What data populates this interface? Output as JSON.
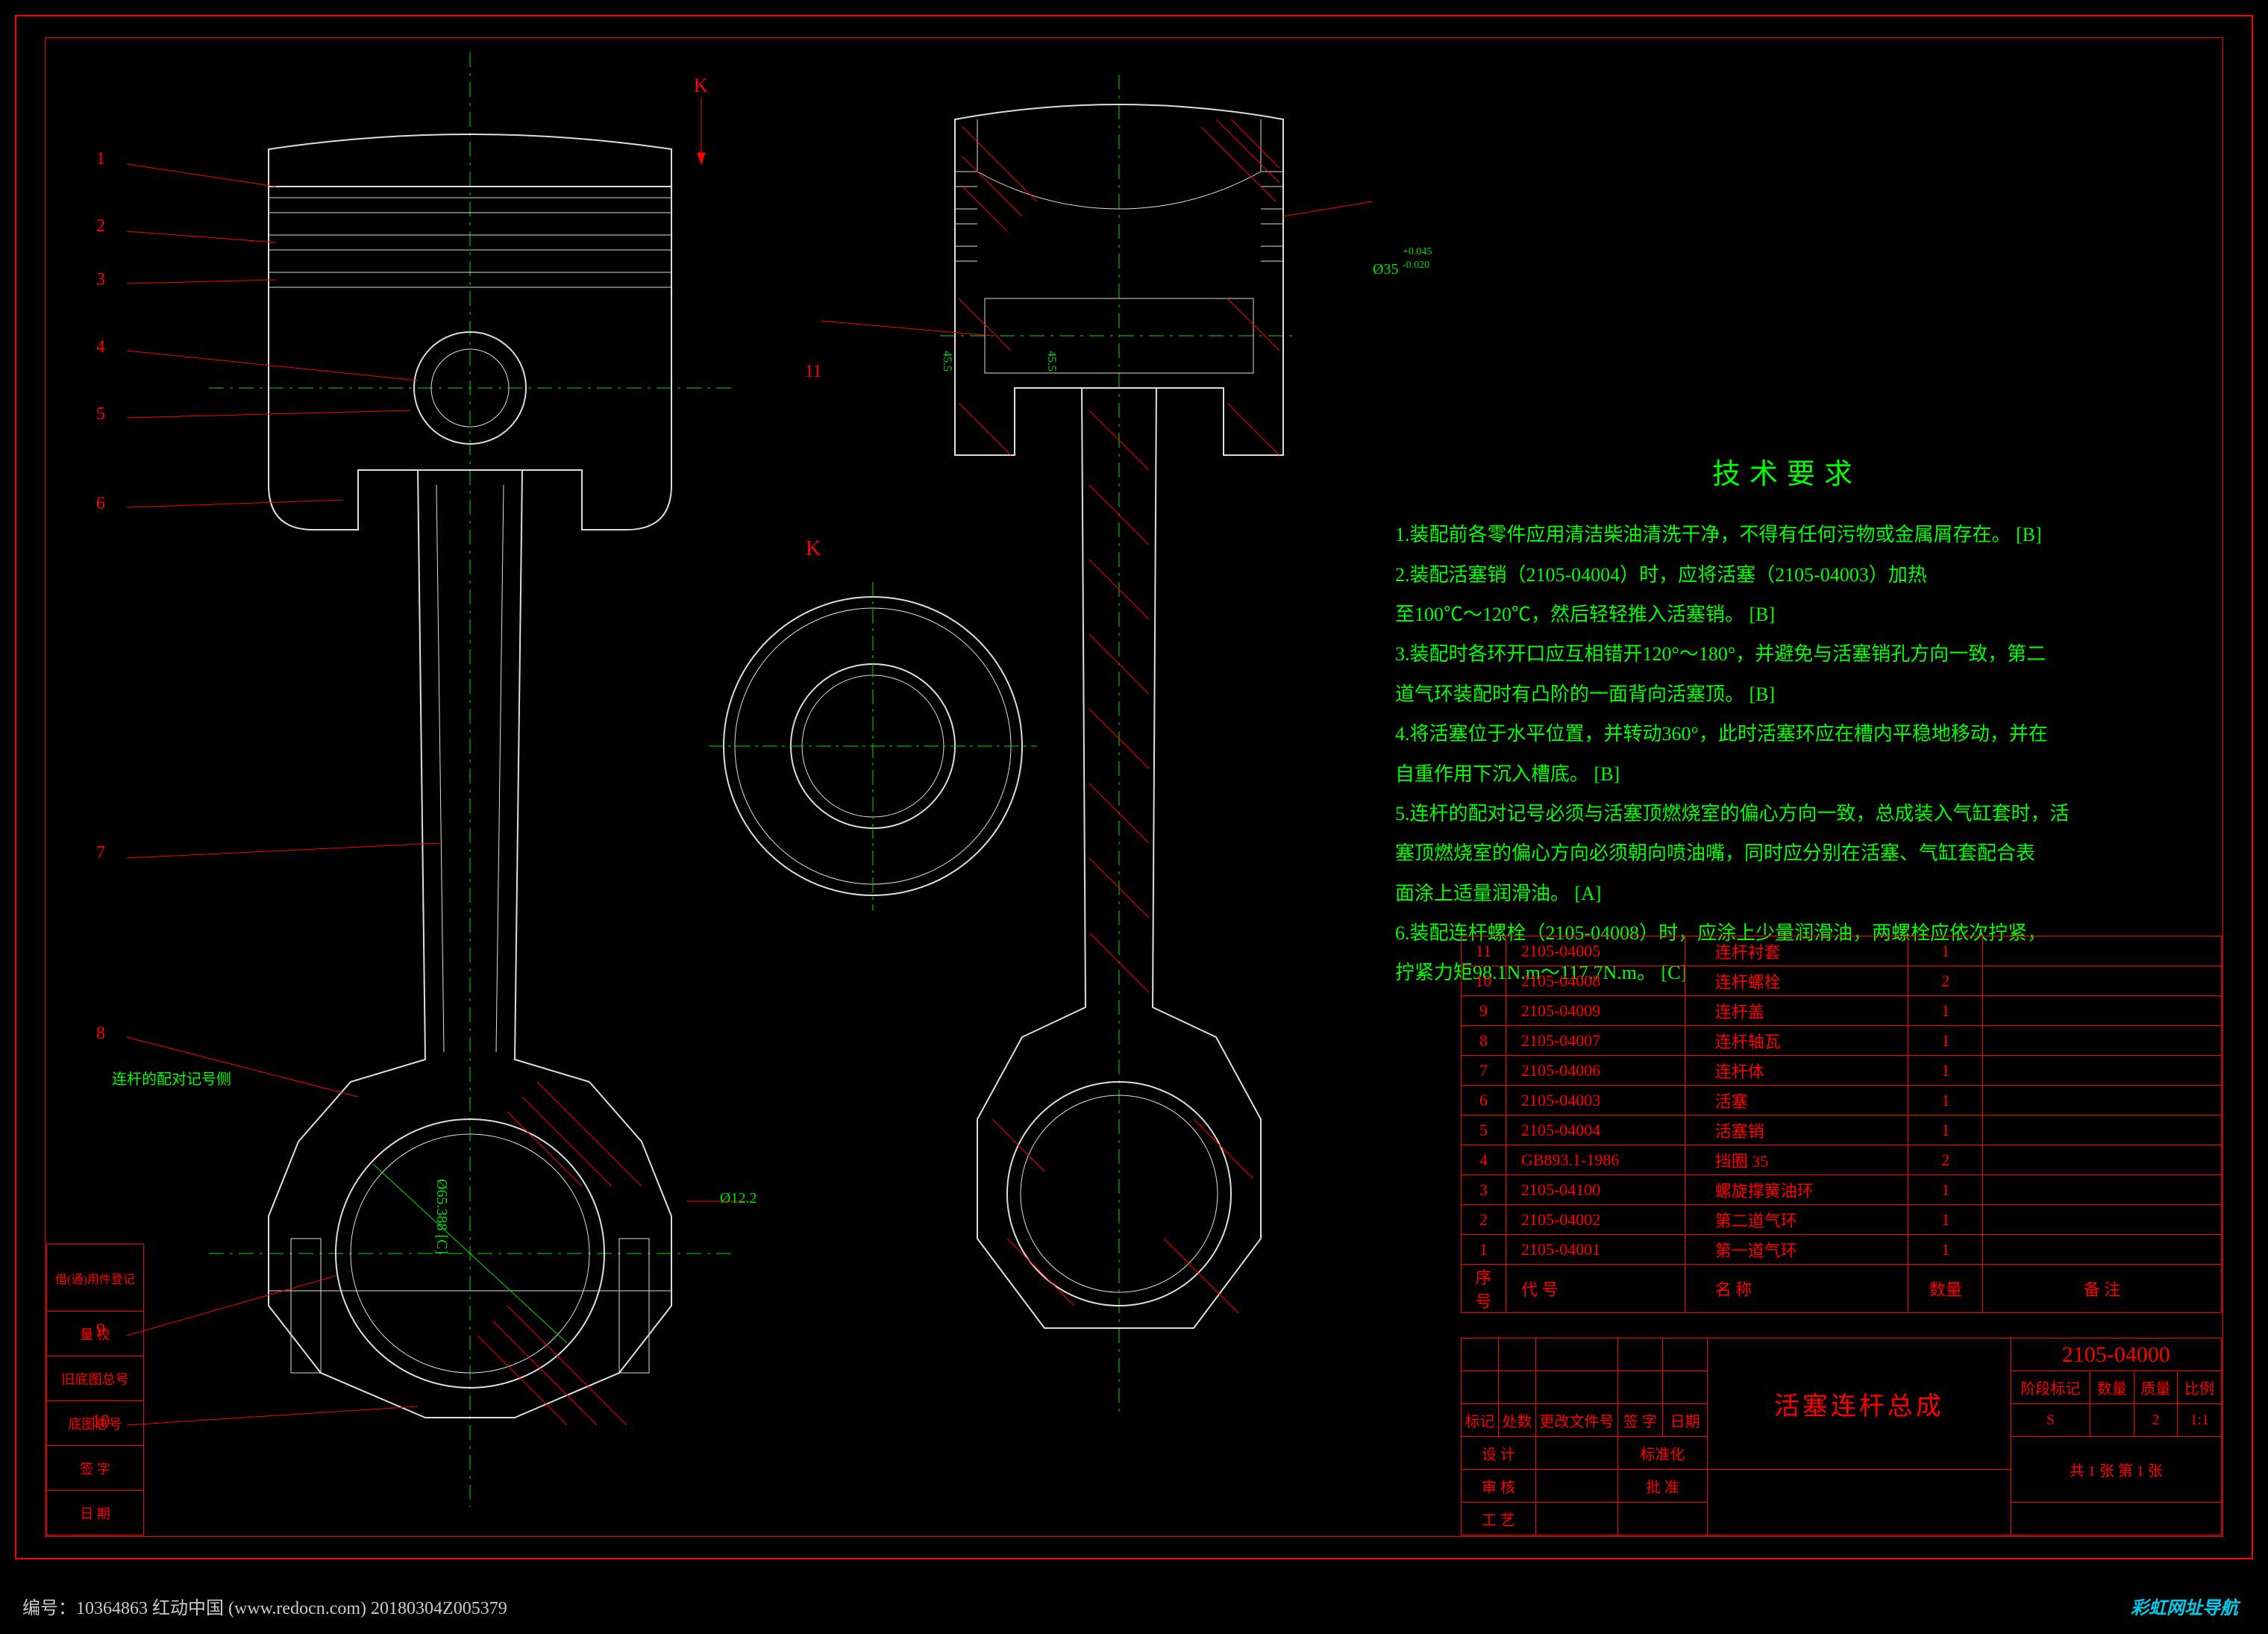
{
  "tech_title": "技术要求",
  "tech_notes": [
    "1.装配前各零件应用清洁柴油清洗干净，不得有任何污物或金属屑存在。 [B]",
    "2.装配活塞销（2105-04004）时，应将活塞（2105-04003）加热",
    "  至100℃～120℃，然后轻轻推入活塞销。 [B]",
    "3.装配时各环开口应互相错开120°～180°，并避免与活塞销孔方向一致，第二",
    "  道气环装配时有凸阶的一面背向活塞顶。 [B]",
    "4.将活塞位于水平位置，并转动360°，此时活塞环应在槽内平稳地移动，并在",
    "  自重作用下沉入槽底。 [B]",
    "5.连杆的配对记号必须与活塞顶燃烧室的偏心方向一致，总成装入气缸套时，活",
    "  塞顶燃烧室的偏心方向必须朝向喷油嘴，同时应分别在活塞、气缸套配合表",
    "  面涂上适量润滑油。 [A]",
    "6.装配连杆螺栓（2105-04008）时，应涂上少量润滑油，两螺栓应依次拧紧，",
    "  拧紧力矩98.1N.m～117.7N.m。 [C]"
  ],
  "bom_header": [
    "序号",
    "代    号",
    "名    称",
    "数量",
    "备    注"
  ],
  "bom_rows": [
    [
      "11",
      "2105-04005",
      "连杆衬套",
      "1",
      ""
    ],
    [
      "10",
      "2105-04008",
      "连杆螺栓",
      "2",
      ""
    ],
    [
      "9",
      "2105-04009",
      "连杆盖",
      "1",
      ""
    ],
    [
      "8",
      "2105-04007",
      "连杆轴瓦",
      "1",
      ""
    ],
    [
      "7",
      "2105-04006",
      "连杆体",
      "1",
      ""
    ],
    [
      "6",
      "2105-04003",
      "活塞",
      "1",
      ""
    ],
    [
      "5",
      "2105-04004",
      "活塞销",
      "1",
      ""
    ],
    [
      "4",
      "GB893.1-1986",
      "挡圈 35",
      "2",
      ""
    ],
    [
      "3",
      "2105-04100",
      "螺旋撑簧油环",
      "1",
      ""
    ],
    [
      "2",
      "2105-04002",
      "第二道气环",
      "1",
      ""
    ],
    [
      "1",
      "2105-04001",
      "第一道气环",
      "1",
      ""
    ]
  ],
  "title_block": {
    "assembly_name": "活塞连杆总成",
    "drawing_no": "2105-04000",
    "row_hdr": [
      "标记",
      "处数",
      "更改文件号",
      "签 字",
      "日期"
    ],
    "rows_left": [
      "设 计",
      "审 核",
      "工 艺"
    ],
    "rows_right": [
      "标准化",
      "批 准"
    ],
    "meta_hdr": [
      "阶段标记",
      "数量",
      "质量",
      "比例"
    ],
    "meta_val": [
      "S",
      "",
      "2",
      "1:1"
    ],
    "sheet": "共  1  张    第  1  张"
  },
  "left_stamp": [
    "借(通)用件登记",
    "量  校",
    "旧底图总号",
    "底图总号",
    "签  字",
    "日  期"
  ],
  "item_numbers": [
    "1",
    "2",
    "3",
    "4",
    "5",
    "6",
    "7",
    "8",
    "9",
    "10",
    "11"
  ],
  "dimensions": {
    "d1": "Ø12.2",
    "d2": "Ø65.388 [C]",
    "d3": "Ø35",
    "tol_upper": "+0.045",
    "tol_lower": "-0.020",
    "d4": "45.5",
    "d5": "45.5"
  },
  "annotations": {
    "mark_side": "连杆的配对记号侧",
    "view_k": "K",
    "arrow_k": "K"
  },
  "watermark_left": "编号：10364863    红动中国 (www.redocn.com)    20180304Z005379",
  "watermark_right": "彩虹网址导航"
}
